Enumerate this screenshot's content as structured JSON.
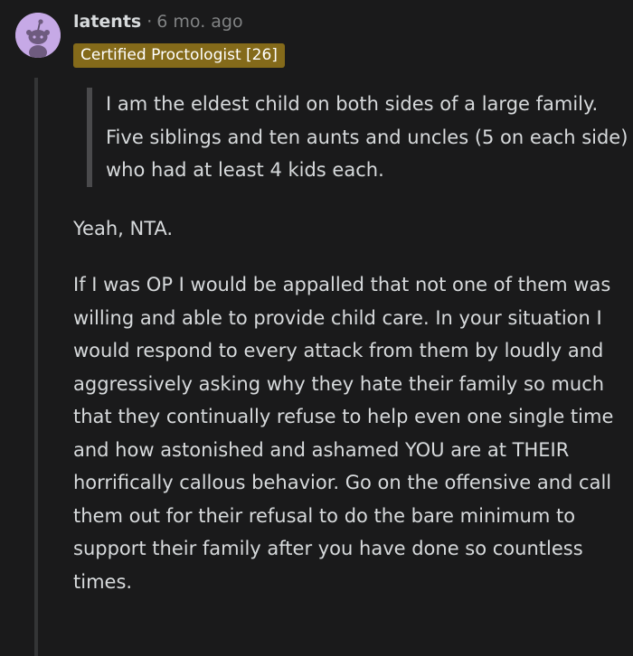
{
  "comment": {
    "username": "latents",
    "separator": "·",
    "timestamp": "6 mo. ago",
    "flair": "Certified Proctologist [26]",
    "quote": "I am the eldest child on both sides of a large family. Five siblings and ten aunts and uncles (5 on each side) who had at least 4 kids each.",
    "paragraphs": [
      "Yeah, NTA.",
      "If I was OP I would be appalled that not one of them was willing and able to provide child care. In your situation I would respond to every attack from them by loudly and aggressively asking why they hate their family so much that they continually refuse to help even one single time and how astonished and ashamed YOU are at THEIR horrifically callous behavior. Go on the offensive and call them out for their refusal to do the bare minimum to support their family after you have done so countless times."
    ]
  },
  "colors": {
    "background": "#1a1a1b",
    "text": "#d7dadc",
    "meta": "#818384",
    "flair_bg": "#846a1a",
    "avatar_bg": "#c6a9e6",
    "thread_line": "#343536"
  },
  "icons": {
    "avatar": "snoo-avatar-icon"
  }
}
